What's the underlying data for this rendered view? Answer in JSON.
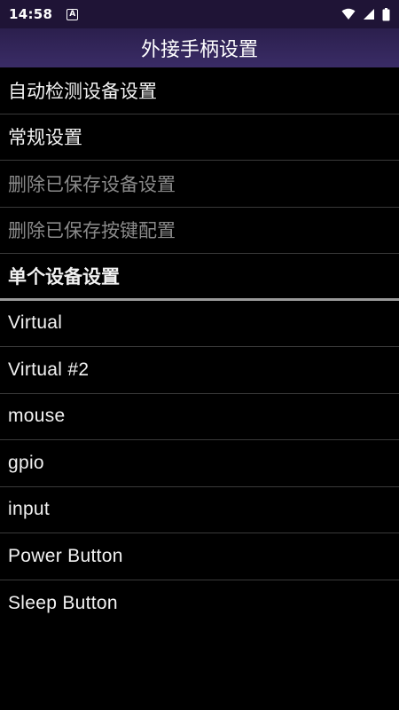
{
  "status_bar": {
    "time": "14:58",
    "notification_letter": "A",
    "icons": [
      "wifi-icon",
      "signal-icon",
      "battery-icon"
    ]
  },
  "title_bar": {
    "title": "外接手柄设置"
  },
  "settings_items": [
    {
      "label": "自动检测设备设置",
      "enabled": true
    },
    {
      "label": "常规设置",
      "enabled": true
    },
    {
      "label": "删除已保存设备设置",
      "enabled": false
    },
    {
      "label": "删除已保存按键配置",
      "enabled": false
    }
  ],
  "section_header": "单个设备设置",
  "devices": [
    "Virtual",
    "Virtual #2",
    "mouse",
    "gpio",
    "input",
    "Power Button",
    "Sleep Button"
  ],
  "colors": {
    "status_bar_bg": "#1f1436",
    "title_bar_bg": "#3a2c66",
    "background": "#000000",
    "text": "#f2f2f2",
    "disabled_text": "#8a8a8a",
    "divider": "#3a3a3a"
  }
}
